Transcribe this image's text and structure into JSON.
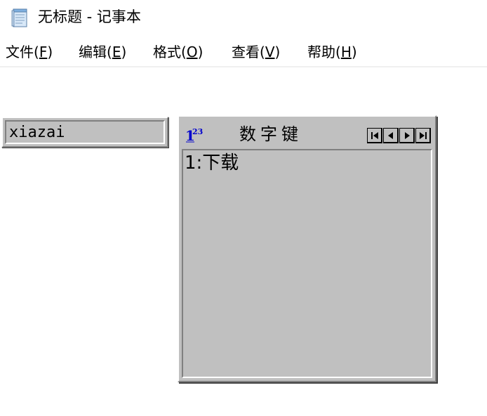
{
  "window": {
    "title": "无标题 - 记事本",
    "icon": "notepad-icon"
  },
  "menu": {
    "items": [
      {
        "prefix": "文件(",
        "accel": "F",
        "suffix": ")"
      },
      {
        "prefix": "编辑(",
        "accel": "E",
        "suffix": ")"
      },
      {
        "prefix": "格式(",
        "accel": "O",
        "suffix": ")"
      },
      {
        "prefix": "查看(",
        "accel": "V",
        "suffix": ")"
      },
      {
        "prefix": "帮助(",
        "accel": "H",
        "suffix": ")"
      }
    ]
  },
  "ime": {
    "composition": "xiazai",
    "mode_label": "数字键",
    "logo_icon": "ime-123-logo-icon",
    "nav_icons": [
      "first-page-icon",
      "prev-page-icon",
      "next-page-icon",
      "last-page-icon"
    ],
    "candidates": [
      {
        "text": "1:下载"
      }
    ]
  },
  "colors": {
    "ime_face": "#c0c0c0",
    "logo_blue": "#0000cc"
  }
}
